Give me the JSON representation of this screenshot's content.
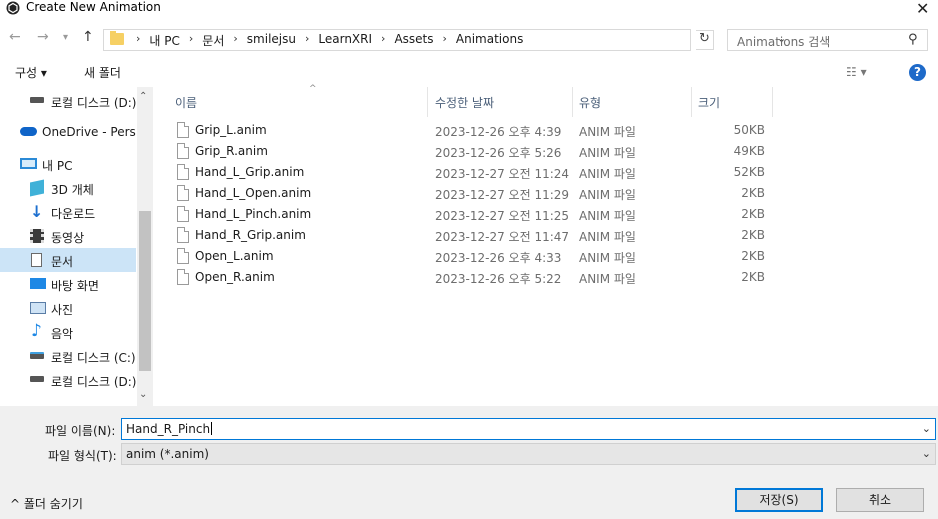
{
  "window": {
    "title": "Create New Animation",
    "close_glyph": "✕"
  },
  "address_bar": {
    "path": [
      "내 PC",
      "문서",
      "smilejsu",
      "LearnXRI",
      "Assets",
      "Animations"
    ],
    "search_placeholder": "Animations 검색"
  },
  "toolbar": {
    "organize_label": "구성 ▾",
    "new_folder_label": "새 폴더"
  },
  "nav_pane": {
    "items": [
      {
        "label": "로컬 디스크 (D:)",
        "icon": "drive-icon"
      },
      {
        "label": "OneDrive - Personal",
        "icon": "onedrive-icon"
      },
      {
        "label": "내 PC",
        "icon": "pc-icon"
      },
      {
        "label": "3D 개체",
        "icon": "3d-objects-icon"
      },
      {
        "label": "다운로드",
        "icon": "download-icon"
      },
      {
        "label": "동영상",
        "icon": "video-icon"
      },
      {
        "label": "문서",
        "icon": "document-icon",
        "selected": true
      },
      {
        "label": "바탕 화면",
        "icon": "desktop-icon"
      },
      {
        "label": "사진",
        "icon": "pictures-icon"
      },
      {
        "label": "음악",
        "icon": "music-icon"
      },
      {
        "label": "로컬 디스크 (C:)",
        "icon": "drive-icon"
      },
      {
        "label": "로컬 디스크 (D:)",
        "icon": "drive-icon"
      }
    ]
  },
  "file_list": {
    "columns": [
      "이름",
      "수정한 날짜",
      "유형",
      "크기"
    ],
    "rows": [
      {
        "name": "Grip_L.anim",
        "date": "2023-12-26 오후 4:39",
        "type": "ANIM 파일",
        "size": "50KB"
      },
      {
        "name": "Grip_R.anim",
        "date": "2023-12-26 오후 5:26",
        "type": "ANIM 파일",
        "size": "49KB"
      },
      {
        "name": "Hand_L_Grip.anim",
        "date": "2023-12-27 오전 11:24",
        "type": "ANIM 파일",
        "size": "52KB"
      },
      {
        "name": "Hand_L_Open.anim",
        "date": "2023-12-27 오전 11:29",
        "type": "ANIM 파일",
        "size": "2KB"
      },
      {
        "name": "Hand_L_Pinch.anim",
        "date": "2023-12-27 오전 11:25",
        "type": "ANIM 파일",
        "size": "2KB"
      },
      {
        "name": "Hand_R_Grip.anim",
        "date": "2023-12-27 오전 11:47",
        "type": "ANIM 파일",
        "size": "2KB"
      },
      {
        "name": "Open_L.anim",
        "date": "2023-12-26 오후 4:33",
        "type": "ANIM 파일",
        "size": "2KB"
      },
      {
        "name": "Open_R.anim",
        "date": "2023-12-26 오후 5:22",
        "type": "ANIM 파일",
        "size": "2KB"
      }
    ]
  },
  "save_form": {
    "filename_label": "파일 이름(N):",
    "filename_value": "Hand_R_Pinch",
    "filetype_label": "파일 형식(T):",
    "filetype_value": "anim (*.anim)",
    "hide_folders_label": "^ 폴더 숨기기",
    "save_label": "저장(S)",
    "cancel_label": "취소"
  },
  "colors": {
    "selection": "#cce4f7",
    "accent": "#0078d7",
    "help": "#1e6ac9",
    "folder": "#f6d064"
  }
}
